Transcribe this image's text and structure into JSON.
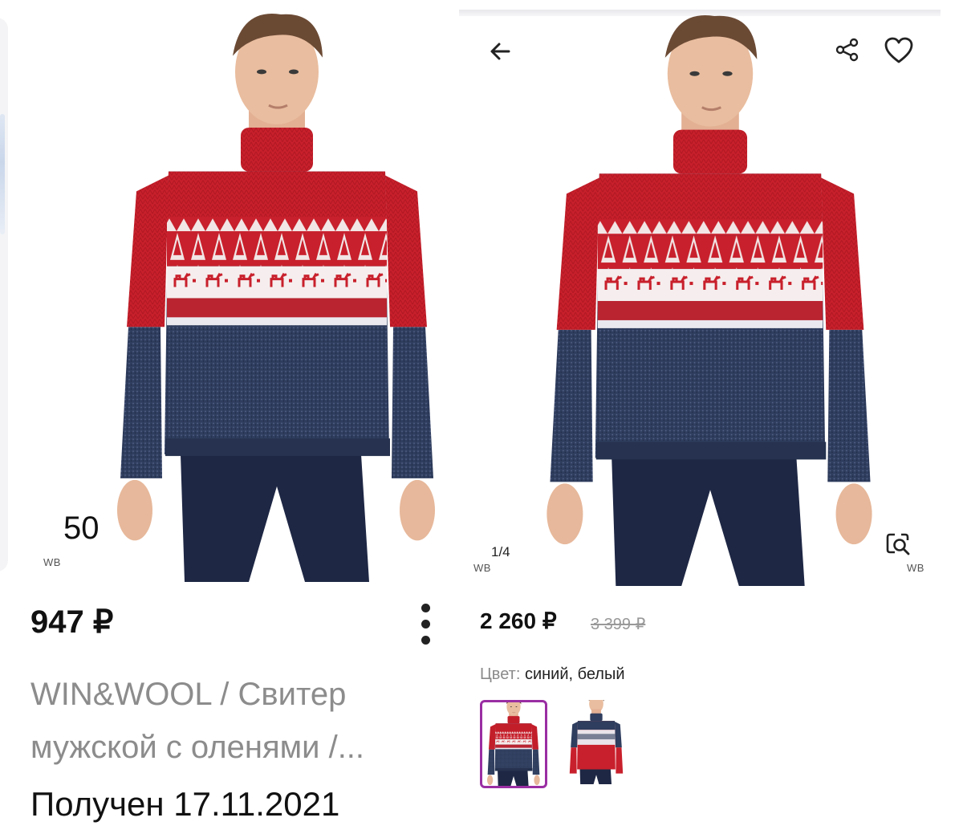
{
  "left": {
    "size": "50",
    "watermark": "WB",
    "price": "947 ₽",
    "title": "WIN&WOOL / Свитер мужской с оленями /...",
    "received": "Получен 17.11.2021"
  },
  "right": {
    "page_counter": "1/4",
    "watermark": "WB",
    "price": "2 260 ₽",
    "old_price": "3 399 ₽",
    "color_label": "Цвет:",
    "color_value": "синий, белый",
    "variants": [
      "red-blue",
      "blue-red"
    ]
  },
  "icons": {
    "back": "arrow-left-icon",
    "share": "share-icon",
    "favorite": "heart-icon",
    "search_image": "image-search-icon",
    "more": "more-vertical-icon"
  },
  "colors": {
    "sweater_red": "#c8202c",
    "sweater_navy": "#2f3d5e",
    "jeans": "#1e2744",
    "accent_purple": "#9a2ea3"
  }
}
